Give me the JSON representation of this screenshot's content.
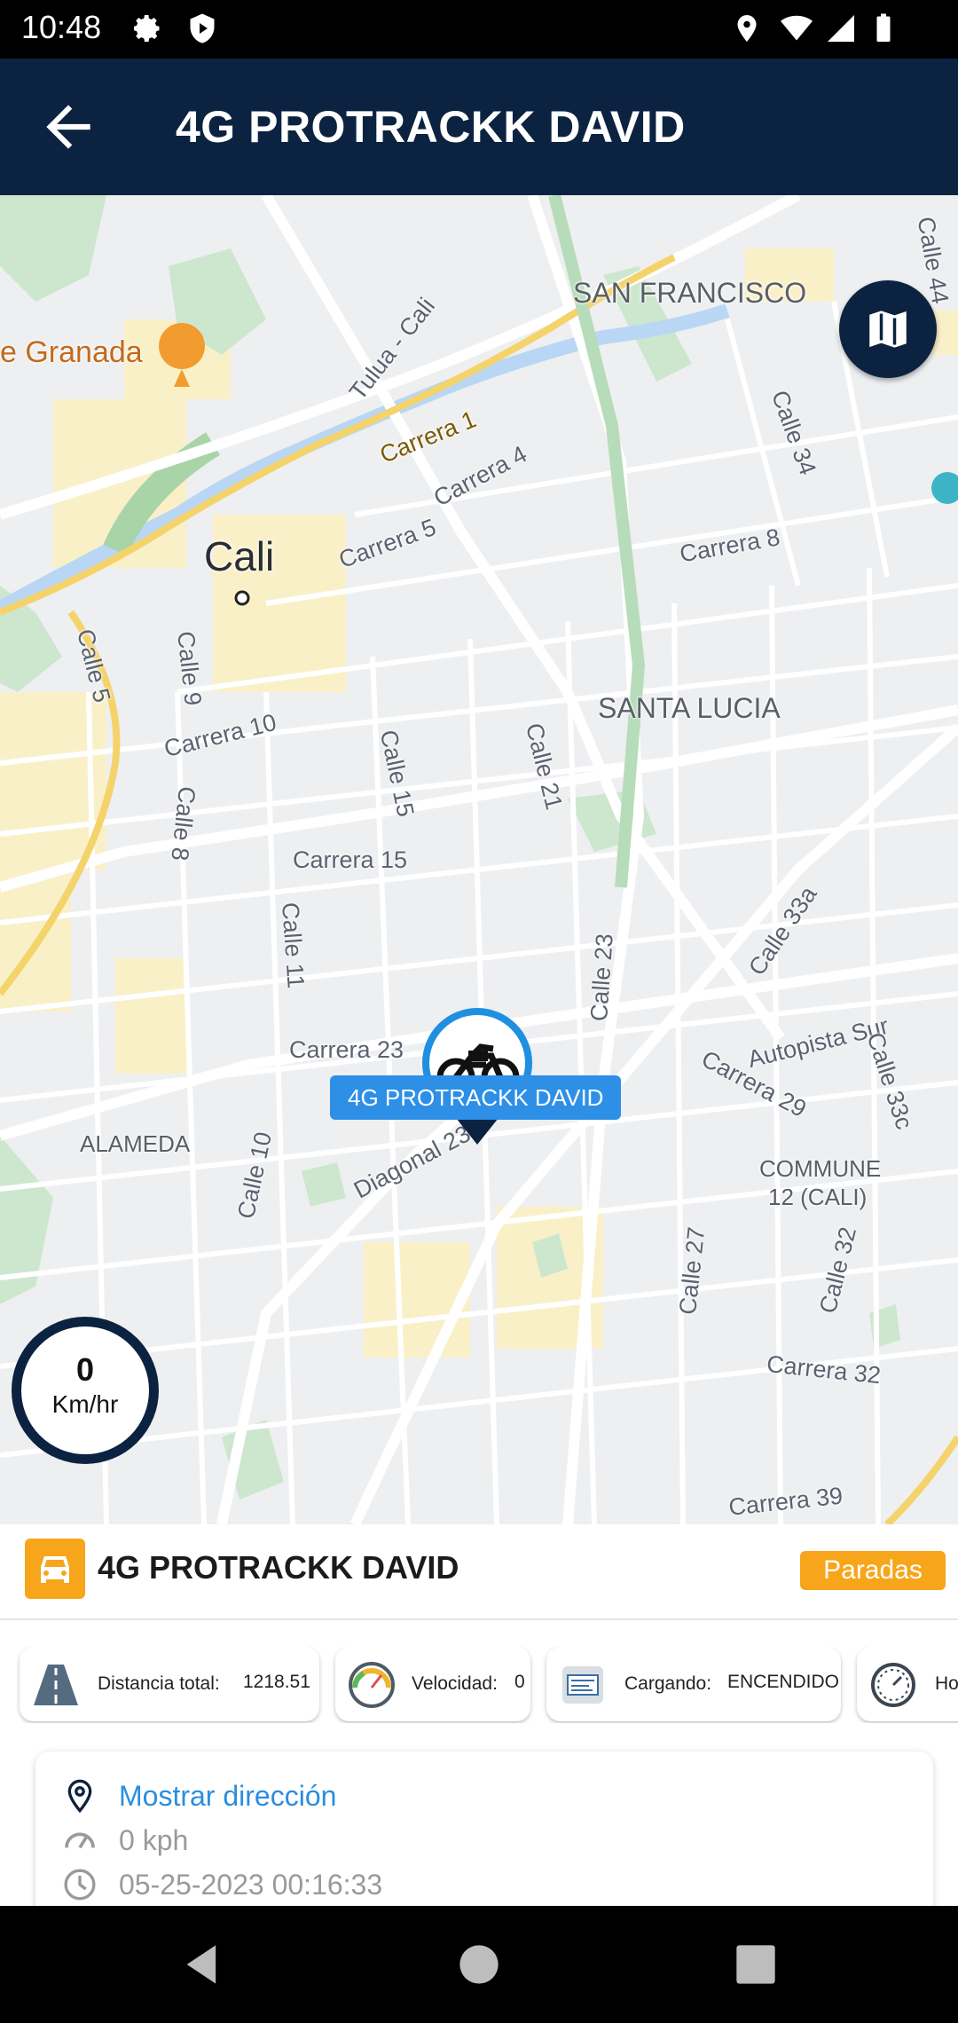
{
  "status_bar": {
    "time": "10:48",
    "icons": [
      "gear-icon",
      "shield-play-icon",
      "location-icon",
      "wifi-icon",
      "signal-icon",
      "battery-icon"
    ]
  },
  "app_bar": {
    "title": "4G PROTRACKK DAVID",
    "back_icon": "arrow-left-icon"
  },
  "map": {
    "labels": {
      "granada": "e Granada",
      "san_francisco": "SAN FRANCISCO",
      "calle44": "Calle 44",
      "tulua": "Tulua - Cali",
      "carrera1": "Carrera 1",
      "carrera4": "Carrera 4",
      "carrera5": "Carrera 5",
      "calle34": "Calle 34",
      "carrera8": "Carrera 8",
      "cali": "Cali",
      "calle5": "Calle 5",
      "calle9": "Calle 9",
      "santa_lucia": "SANTA LUCIA",
      "carrera10": "Carrera 10",
      "calle15": "Calle 15",
      "calle21": "Calle 21",
      "calle8": "Calle 8",
      "carrera15": "Carrera 15",
      "calle11": "Calle 11",
      "calle33a": "Calle 33a",
      "calle23": "Calle 23",
      "autopista_sur": "Autopista Sur",
      "carrera23": "Carrera 23",
      "calle33c": "Calle 33c",
      "carrera29": "Carrera 29",
      "alameda": "ALAMEDA",
      "diagonal23": "Diagonal 23",
      "calle10": "Calle 10",
      "commune_line1": "COMMUNE",
      "commune_line2": "12 (CALI)",
      "calle27": "Calle 27",
      "calle32": "Calle 32",
      "carrera32": "Carrera 32",
      "carrera39": "Carrera 39"
    },
    "vehicle_label": "4G PROTRACKK DAVID",
    "layers_icon": "map-icon",
    "speed": {
      "value": "0",
      "unit": "Km/hr"
    }
  },
  "panel": {
    "vehicle_icon": "car-icon",
    "vehicle_name": "4G PROTRACKK DAVID",
    "paradas_label": "Paradas",
    "chips": [
      {
        "icon": "road-icon",
        "label": "Distancia total:",
        "value": "1218.51"
      },
      {
        "icon": "speedometer-icon",
        "label": "Velocidad:",
        "value": "0"
      },
      {
        "icon": "ignition-icon",
        "label": "Cargando:",
        "value": "ENCENDIDO"
      },
      {
        "icon": "clock-gauge-icon",
        "label": "Ho",
        "value": ""
      }
    ],
    "address_link": "Mostrar dirección",
    "speed_text": "0 kph",
    "datetime": "05-25-2023 00:16:33"
  },
  "nav_bar": {
    "icons": [
      "back-triangle-icon",
      "home-circle-icon",
      "recents-square-icon"
    ]
  }
}
